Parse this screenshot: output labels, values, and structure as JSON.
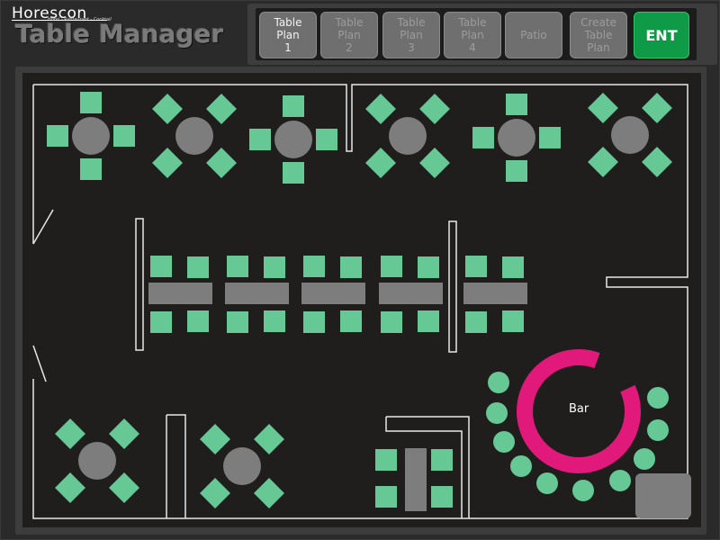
{
  "header": {
    "brand": "Horescon",
    "tagline": "Hotel - Restaurant - Cocktail",
    "title": "Table Manager"
  },
  "tabs": [
    {
      "label": "Table\nPlan\n1",
      "active": true
    },
    {
      "label": "Table\nPlan\n2",
      "active": false
    },
    {
      "label": "Table\nPlan\n3",
      "active": false
    },
    {
      "label": "Table\nPlan\n4",
      "active": false
    },
    {
      "label": "Patio",
      "active": false
    },
    {
      "label": "Create\nTable\nPlan",
      "active": false
    }
  ],
  "enter_button": "ENT",
  "floor": {
    "bar_label": "Bar",
    "colors": {
      "seat": "#66c995",
      "table": "#7d7d7d",
      "bar_ring": "#e0197a",
      "wall": "#e8e8e8",
      "floor": "#201d1d"
    }
  }
}
